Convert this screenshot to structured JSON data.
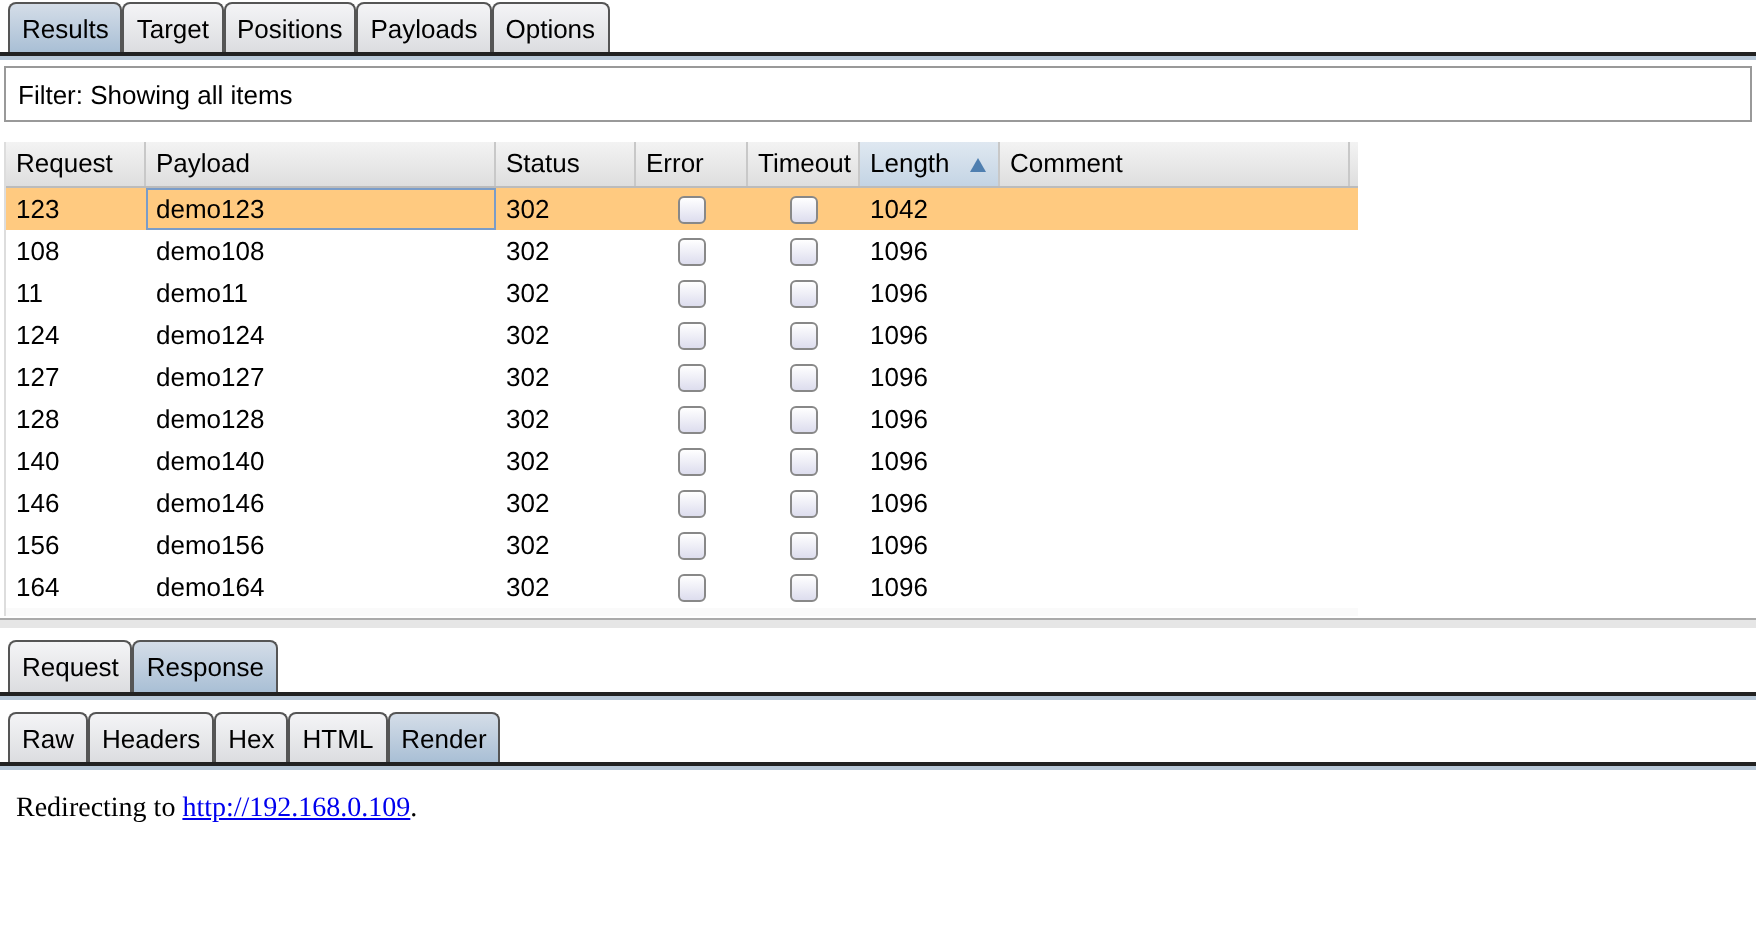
{
  "tabs": [
    {
      "label": "Results",
      "selected": true
    },
    {
      "label": "Target",
      "selected": false
    },
    {
      "label": "Positions",
      "selected": false
    },
    {
      "label": "Payloads",
      "selected": false
    },
    {
      "label": "Options",
      "selected": false
    }
  ],
  "filter": {
    "text": "Filter: Showing all items"
  },
  "table": {
    "columns": [
      {
        "label": "Request",
        "sorted": false
      },
      {
        "label": "Payload",
        "sorted": false
      },
      {
        "label": "Status",
        "sorted": false
      },
      {
        "label": "Error",
        "sorted": false
      },
      {
        "label": "Timeout",
        "sorted": false
      },
      {
        "label": "Length",
        "sorted": true
      },
      {
        "label": "Comment",
        "sorted": false
      }
    ],
    "rows": [
      {
        "request": "123",
        "payload": "demo123",
        "status": "302",
        "error": false,
        "timeout": false,
        "length": "1042",
        "selected": true
      },
      {
        "request": "108",
        "payload": "demo108",
        "status": "302",
        "error": false,
        "timeout": false,
        "length": "1096",
        "selected": false
      },
      {
        "request": "11",
        "payload": "demo11",
        "status": "302",
        "error": false,
        "timeout": false,
        "length": "1096",
        "selected": false
      },
      {
        "request": "124",
        "payload": "demo124",
        "status": "302",
        "error": false,
        "timeout": false,
        "length": "1096",
        "selected": false
      },
      {
        "request": "127",
        "payload": "demo127",
        "status": "302",
        "error": false,
        "timeout": false,
        "length": "1096",
        "selected": false
      },
      {
        "request": "128",
        "payload": "demo128",
        "status": "302",
        "error": false,
        "timeout": false,
        "length": "1096",
        "selected": false
      },
      {
        "request": "140",
        "payload": "demo140",
        "status": "302",
        "error": false,
        "timeout": false,
        "length": "1096",
        "selected": false
      },
      {
        "request": "146",
        "payload": "demo146",
        "status": "302",
        "error": false,
        "timeout": false,
        "length": "1096",
        "selected": false
      },
      {
        "request": "156",
        "payload": "demo156",
        "status": "302",
        "error": false,
        "timeout": false,
        "length": "1096",
        "selected": false
      },
      {
        "request": "164",
        "payload": "demo164",
        "status": "302",
        "error": false,
        "timeout": false,
        "length": "1096",
        "selected": false
      }
    ]
  },
  "message_tabs": [
    {
      "label": "Request",
      "selected": false
    },
    {
      "label": "Response",
      "selected": true
    }
  ],
  "view_tabs": [
    {
      "label": "Raw",
      "selected": false
    },
    {
      "label": "Headers",
      "selected": false
    },
    {
      "label": "Hex",
      "selected": false
    },
    {
      "label": "HTML",
      "selected": false
    },
    {
      "label": "Render",
      "selected": true
    }
  ],
  "render": {
    "text_before": "Redirecting to ",
    "link": "http://192.168.0.109",
    "text_after": "."
  }
}
